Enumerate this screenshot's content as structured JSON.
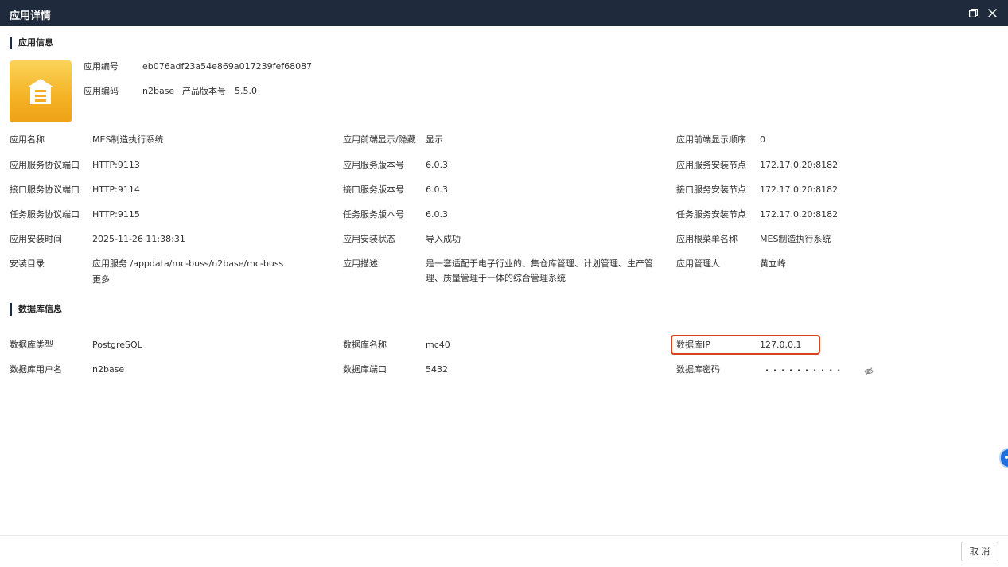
{
  "window": {
    "title": "应用详情"
  },
  "sections": {
    "app_info": "应用信息",
    "db_info": "数据库信息"
  },
  "header": {
    "app_no_label": "应用编号",
    "app_no": "eb076adf23a54e869a017239fef68087",
    "app_code_label": "应用编码",
    "app_code": "n2base",
    "product_version_label": "产品版本号",
    "product_version": "5.5.0"
  },
  "fields": {
    "name_label": "应用名称",
    "name": "MES制造执行系统",
    "frontend_show_label": "应用前端显示/隐藏",
    "frontend_show": "显示",
    "frontend_order_label": "应用前端显示顺序",
    "frontend_order": "0",
    "app_port_label": "应用服务协议端口",
    "app_port": "HTTP:9113",
    "app_ver_label": "应用服务版本号",
    "app_ver": "6.0.3",
    "app_node_label": "应用服务安装节点",
    "app_node": "172.17.0.20:8182",
    "api_port_label": "接口服务协议端口",
    "api_port": "HTTP:9114",
    "api_ver_label": "接口服务版本号",
    "api_ver": "6.0.3",
    "api_node_label": "接口服务安装节点",
    "api_node": "172.17.0.20:8182",
    "task_port_label": "任务服务协议端口",
    "task_port": "HTTP:9115",
    "task_ver_label": "任务服务版本号",
    "task_ver": "6.0.3",
    "task_node_label": "任务服务安装节点",
    "task_node": "172.17.0.20:8182",
    "install_time_label": "应用安装时间",
    "install_time": "2025-11-26 11:38:31",
    "install_status_label": "应用安装状态",
    "install_status": "导入成功",
    "root_menu_label": "应用根菜单名称",
    "root_menu": "MES制造执行系统",
    "install_dir_label": "安装目录",
    "install_dir": "应用服务 /appdata/mc-buss/n2base/mc-buss",
    "more_link": "更多",
    "desc_label": "应用描述",
    "desc": "是一套适配于电子行业的、集仓库管理、计划管理、生产管理、质量管理于一体的综合管理系统",
    "manager_label": "应用管理人",
    "manager": "黄立峰"
  },
  "database": {
    "type_label": "数据库类型",
    "type": "PostgreSQL",
    "name_label": "数据库名称",
    "name": "mc40",
    "ip_label": "数据库IP",
    "ip": "127.0.0.1",
    "user_label": "数据库用户名",
    "user": "n2base",
    "port_label": "数据库端口",
    "port": "5432",
    "password_label": "数据库密码",
    "password_mask": "· · · · · · · · · ·"
  },
  "footer": {
    "cancel_label": "取 消"
  },
  "icons": {
    "restore": "restore-window-icon",
    "close": "close-icon",
    "app": "warehouse-icon",
    "eye": "eye-off-icon"
  },
  "colors": {
    "titlebar": "#1f2b3d",
    "icon_gradient_top": "#fbd45a",
    "icon_gradient_bottom": "#eea117",
    "highlight": "#d9431c"
  }
}
